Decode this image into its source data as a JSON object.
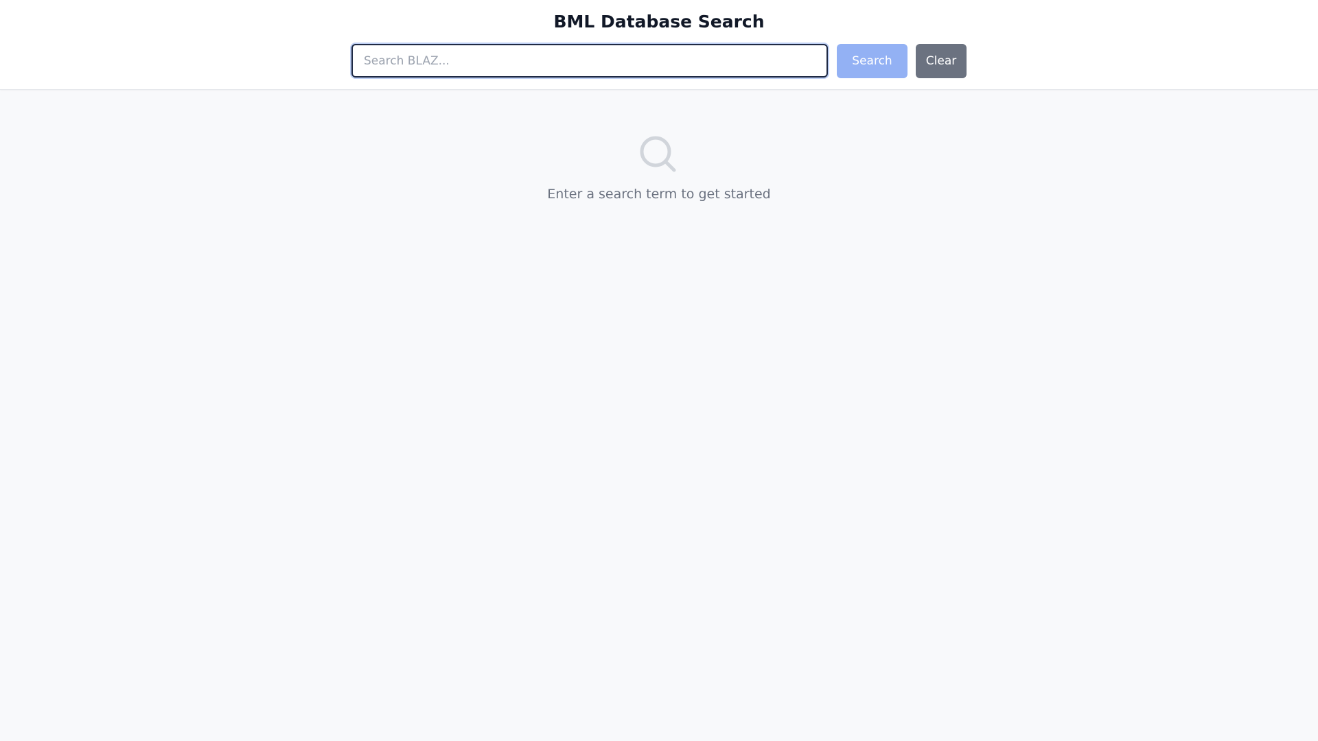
{
  "header": {
    "title": "BML Database Search"
  },
  "search": {
    "value": "",
    "placeholder": "Search BLAZ...",
    "search_label": "Search",
    "clear_label": "Clear"
  },
  "empty_state": {
    "icon": "search-icon",
    "message": "Enter a search term to get started"
  },
  "colors": {
    "page_background": "#f8f9fb",
    "header_background": "#ffffff",
    "search_button": "#93b1f4",
    "clear_button": "#6b7280",
    "input_border": "#1f2a44",
    "muted_text": "#6b7280",
    "icon": "#d1d5db"
  }
}
